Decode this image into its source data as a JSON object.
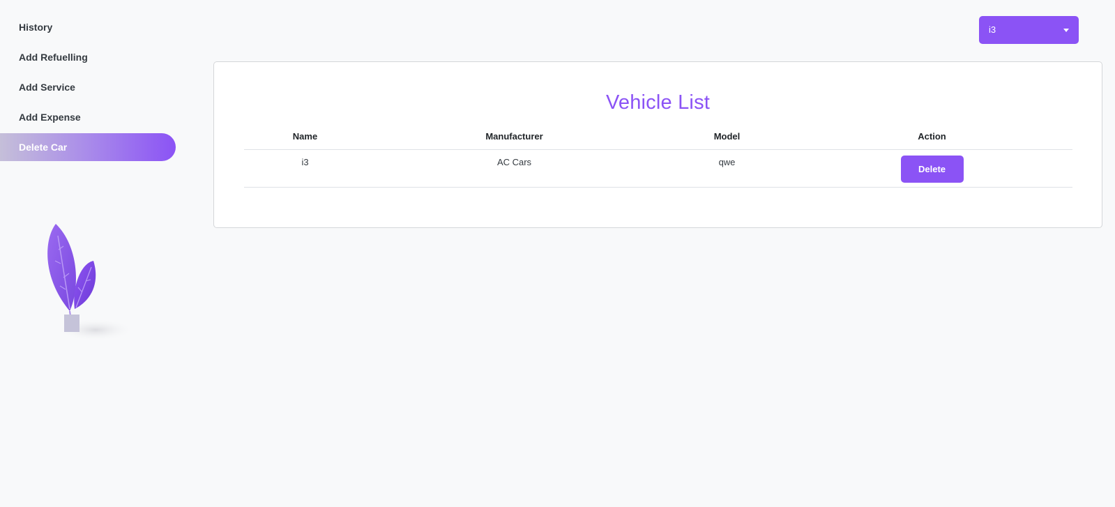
{
  "sidebar": {
    "items": [
      {
        "label": "History"
      },
      {
        "label": "Add Refuelling"
      },
      {
        "label": "Add Service"
      },
      {
        "label": "Add Expense"
      },
      {
        "label": "Delete Car"
      }
    ],
    "active_index": 4,
    "illustration_icon": "plant-icon"
  },
  "vehicle_select": {
    "value": "i3",
    "caret_icon": "caret-down-icon"
  },
  "main": {
    "title": "Vehicle List",
    "table": {
      "headers": [
        "Name",
        "Manufacturer",
        "Model",
        "Action"
      ],
      "rows": [
        {
          "name": "i3",
          "manufacturer": "AC Cars",
          "model": "qwe",
          "action": "Delete"
        }
      ]
    }
  },
  "colors": {
    "accent": "#8b53f5",
    "background": "#f8f9fa",
    "card": "#ffffff"
  }
}
